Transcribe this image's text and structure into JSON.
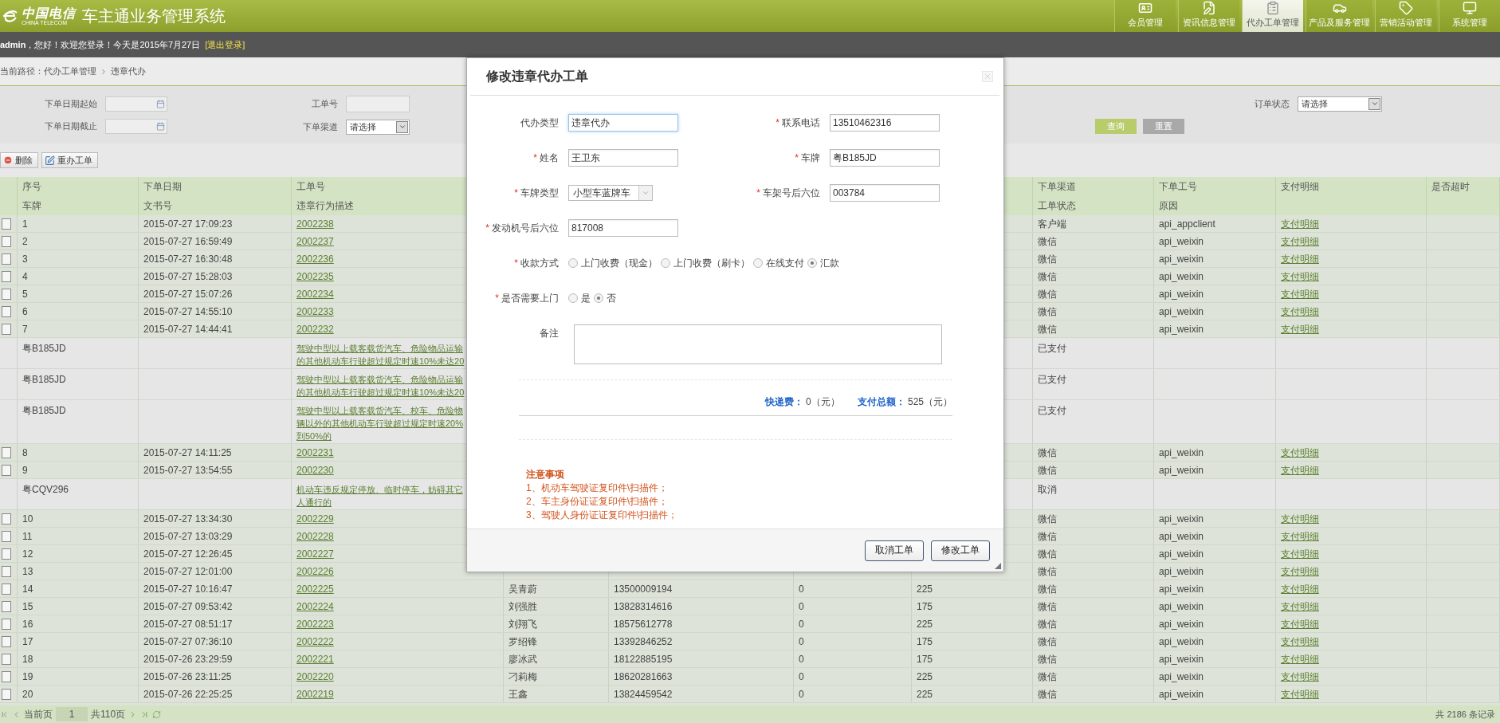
{
  "header": {
    "logo": {
      "mark": "中国电信",
      "sub": "CHINA TELECOM"
    },
    "title": "车主通业务管理系统",
    "nav": [
      {
        "label": "会员管理",
        "selected": false
      },
      {
        "label": "资讯信息管理",
        "selected": false
      },
      {
        "label": "代办工单管理",
        "selected": true
      },
      {
        "label": "产品及服务管理",
        "selected": false
      },
      {
        "label": "营销活动管理",
        "selected": false
      },
      {
        "label": "系统管理",
        "selected": false
      }
    ]
  },
  "user_bar": {
    "greeting": "**admin**，您好！欢迎您登录！今天是2015年7月27日",
    "logout": "[退出登录]"
  },
  "breadcrumb": {
    "path": "当前路径：代办工单管理",
    "current": "违章代办"
  },
  "filters": [
    {
      "label": "下单日期起始",
      "kind": "date"
    },
    {
      "label": "工单号",
      "kind": "text"
    },
    {
      "label": "订单状态",
      "kind": "select",
      "value": "请选择"
    },
    {
      "label": "下单日期截止",
      "kind": "date"
    },
    {
      "label": "下单渠道",
      "kind": "select",
      "value": "请选择"
    }
  ],
  "filter_buttons": [
    {
      "label": "查询",
      "kind": "primary"
    },
    {
      "label": "重置",
      "kind": "secondary"
    }
  ],
  "toolbar": [
    {
      "label": "删除",
      "kind": "delete"
    },
    {
      "label": "重办工单",
      "kind": "redo"
    }
  ],
  "table": {
    "columns": [
      {
        "top": "序号",
        "bottom": "车牌"
      },
      {
        "top": "下单日期",
        "bottom": "文书号"
      },
      {
        "top": "工单号",
        "bottom": "违章行为描述"
      },
      {},
      {},
      {},
      {},
      {
        "top": "下单渠道",
        "bottom": "工单状态"
      },
      {
        "top": "下单工号",
        "bottom": "原因"
      },
      {
        "top": "支付明细"
      },
      {
        "top": "是否超时"
      }
    ],
    "rows": [
      {
        "kind": "order",
        "checked": false,
        "no": "1",
        "date": "2015-07-27 17:09:23",
        "order_no": "2002238",
        "channel": "客户端",
        "operator": "api_appclient",
        "payment": "支付明细"
      },
      {
        "kind": "order",
        "checked": false,
        "no": "2",
        "date": "2015-07-27 16:59:49",
        "order_no": "2002237",
        "channel": "微信",
        "operator": "api_weixin",
        "payment": "支付明细"
      },
      {
        "kind": "order",
        "checked": false,
        "no": "3",
        "date": "2015-07-27 16:30:48",
        "order_no": "2002236",
        "channel": "微信",
        "operator": "api_weixin",
        "payment": "支付明细"
      },
      {
        "kind": "order",
        "checked": false,
        "no": "4",
        "date": "2015-07-27 15:28:03",
        "order_no": "2002235",
        "channel": "微信",
        "operator": "api_weixin",
        "payment": "支付明细"
      },
      {
        "kind": "order",
        "checked": false,
        "no": "5",
        "date": "2015-07-27 15:07:26",
        "order_no": "2002234",
        "channel": "微信",
        "operator": "api_weixin",
        "payment": "支付明细"
      },
      {
        "kind": "order",
        "checked": false,
        "no": "6",
        "date": "2015-07-27 14:55:10",
        "order_no": "2002233",
        "channel": "微信",
        "operator": "api_weixin",
        "payment": "支付明细"
      },
      {
        "kind": "order",
        "checked": false,
        "no": "7",
        "date": "2015-07-27 14:44:41",
        "order_no": "2002232",
        "channel": "微信",
        "operator": "api_weixin",
        "payment": "支付明细"
      },
      {
        "kind": "violation",
        "plate": "粤B185JD",
        "description": [
          "驾驶中型以上载客载货汽车、危险物品运输",
          "的其他机动车行驶超过规定时速10%未达20"
        ],
        "status": "已支付"
      },
      {
        "kind": "violation",
        "plate": "粤B185JD",
        "description": [
          "驾驶中型以上载客载货汽车、危险物品运输",
          "的其他机动车行驶超过规定时速10%未达20"
        ],
        "status": "已支付"
      },
      {
        "kind": "violation",
        "plate": "粤B185JD",
        "description": [
          "驾驶中型以上载客载货汽车、校车、危险物",
          "辆以外的其他机动车行驶超过规定时速20%",
          "到50%的"
        ],
        "status": "已支付"
      },
      {
        "kind": "order",
        "checked": false,
        "no": "8",
        "date": "2015-07-27 14:11:25",
        "order_no": "2002231",
        "channel": "微信",
        "operator": "api_weixin",
        "payment": "支付明细"
      },
      {
        "kind": "order",
        "checked": false,
        "no": "9",
        "date": "2015-07-27 13:54:55",
        "order_no": "2002230",
        "channel": "微信",
        "operator": "api_weixin",
        "payment": "支付明细"
      },
      {
        "kind": "violation",
        "plate": "粤CQV296",
        "description": [
          "机动车违反规定停放、临时停车，妨碍其它",
          "人通行的"
        ],
        "status": "取消"
      },
      {
        "kind": "order",
        "checked": false,
        "no": "10",
        "date": "2015-07-27 13:34:30",
        "order_no": "2002229",
        "channel": "微信",
        "operator": "api_weixin",
        "payment": "支付明细"
      },
      {
        "kind": "order",
        "checked": false,
        "no": "11",
        "date": "2015-07-27 13:03:29",
        "order_no": "2002228",
        "channel": "微信",
        "operator": "api_weixin",
        "payment": "支付明细"
      },
      {
        "kind": "order",
        "checked": false,
        "no": "12",
        "date": "2015-07-27 12:26:45",
        "order_no": "2002227",
        "channel": "微信",
        "operator": "api_weixin",
        "payment": "支付明细"
      },
      {
        "kind": "order",
        "checked": false,
        "no": "13",
        "date": "2015-07-27 12:01:00",
        "order_no": "2002226",
        "channel": "微信",
        "operator": "api_weixin",
        "payment": "支付明细"
      },
      {
        "kind": "order",
        "checked": false,
        "no": "14",
        "date": "2015-07-27 10:16:47",
        "order_no": "2002225",
        "name": "吴青蔚",
        "phone": "13500009194",
        "column_6": "0",
        "column_7": "225",
        "channel": "微信",
        "operator": "api_weixin",
        "payment": "支付明细"
      },
      {
        "kind": "order",
        "checked": false,
        "no": "15",
        "date": "2015-07-27 09:53:42",
        "order_no": "2002224",
        "name": "刘强胜",
        "phone": "13828314616",
        "column_6": "0",
        "column_7": "175",
        "channel": "微信",
        "operator": "api_weixin",
        "payment": "支付明细"
      },
      {
        "kind": "order",
        "checked": false,
        "no": "16",
        "date": "2015-07-27 08:51:17",
        "order_no": "2002223",
        "name": "刘翔飞",
        "phone": "18575612778",
        "column_6": "0",
        "column_7": "225",
        "channel": "微信",
        "operator": "api_weixin",
        "payment": "支付明细"
      },
      {
        "kind": "order",
        "checked": false,
        "no": "17",
        "date": "2015-07-27 07:36:10",
        "order_no": "2002222",
        "name": "罗绍锋",
        "phone": "13392846252",
        "column_6": "0",
        "column_7": "175",
        "channel": "微信",
        "operator": "api_weixin",
        "payment": "支付明细"
      },
      {
        "kind": "order",
        "checked": false,
        "no": "18",
        "date": "2015-07-26 23:29:59",
        "order_no": "2002221",
        "name": "廖冰武",
        "phone": "18122885195",
        "column_6": "0",
        "column_7": "175",
        "channel": "微信",
        "operator": "api_weixin",
        "payment": "支付明细"
      },
      {
        "kind": "order",
        "checked": false,
        "no": "19",
        "date": "2015-07-26 23:11:25",
        "order_no": "2002220",
        "name": "刁莉梅",
        "phone": "18620281663",
        "column_6": "0",
        "column_7": "225",
        "channel": "微信",
        "operator": "api_weixin",
        "payment": "支付明细"
      },
      {
        "kind": "order",
        "checked": false,
        "no": "20",
        "date": "2015-07-26 22:25:25",
        "order_no": "2002219",
        "name": "王鑫",
        "phone": "13824459542",
        "column_6": "0",
        "column_7": "225",
        "channel": "微信",
        "operator": "api_weixin",
        "payment": "支付明细"
      }
    ]
  },
  "pagination": {
    "current_label": "当前页",
    "page": "1",
    "total_pages": "共110页",
    "records": "共 2186 条记录"
  },
  "dialog": {
    "title": "修改违章代办工单",
    "fields": [
      {
        "label": "代办类型",
        "kind": "text",
        "value": "违章代办",
        "focused": true
      },
      {
        "label": "联系电话",
        "mark": "*",
        "kind": "text",
        "value": "13510462316",
        "focused": false
      },
      {
        "label": "姓名",
        "mark": "*",
        "kind": "text",
        "value": "王卫东",
        "focused": false
      },
      {
        "label": "车牌",
        "mark": "*",
        "kind": "text",
        "value": "粤B185JD",
        "focused": false
      },
      {
        "label": "车牌类型",
        "mark": "*",
        "kind": "select",
        "value": "小型车蓝牌车",
        "focused": false
      },
      {
        "label": "车架号后六位",
        "mark": "*",
        "kind": "text",
        "value": "003784",
        "focused": false
      },
      {
        "label": "发动机号后六位",
        "mark": "*",
        "kind": "text",
        "value": "817008",
        "focused": false
      }
    ],
    "radio_groups": [
      {
        "label": "收款方式",
        "mark": "*",
        "options": [
          {
            "label": "上门收费（现金）",
            "selected": false
          },
          {
            "label": "上门收费（刷卡）",
            "selected": false
          },
          {
            "label": "在线支付",
            "selected": false
          },
          {
            "label": "汇款",
            "selected": true
          }
        ]
      },
      {
        "label": "是否需要上门",
        "mark": "*",
        "options": [
          {
            "label": "是",
            "selected": false
          },
          {
            "label": "否",
            "selected": true
          }
        ]
      }
    ],
    "remark": {
      "label": "备注"
    },
    "fees": [
      {
        "label": "快递费：",
        "value": "0（元）"
      },
      {
        "label": "支付总额：",
        "value": "525（元）"
      }
    ],
    "notes": {
      "title": "注意事项",
      "items": [
        "1、机动车驾驶证复印件\\扫描件；",
        "2、车主身份证证复印件\\扫描件；",
        "3、驾驶人身份证证复印件\\扫描件；"
      ]
    },
    "buttons": [
      "取消工单",
      "修改工单"
    ]
  }
}
